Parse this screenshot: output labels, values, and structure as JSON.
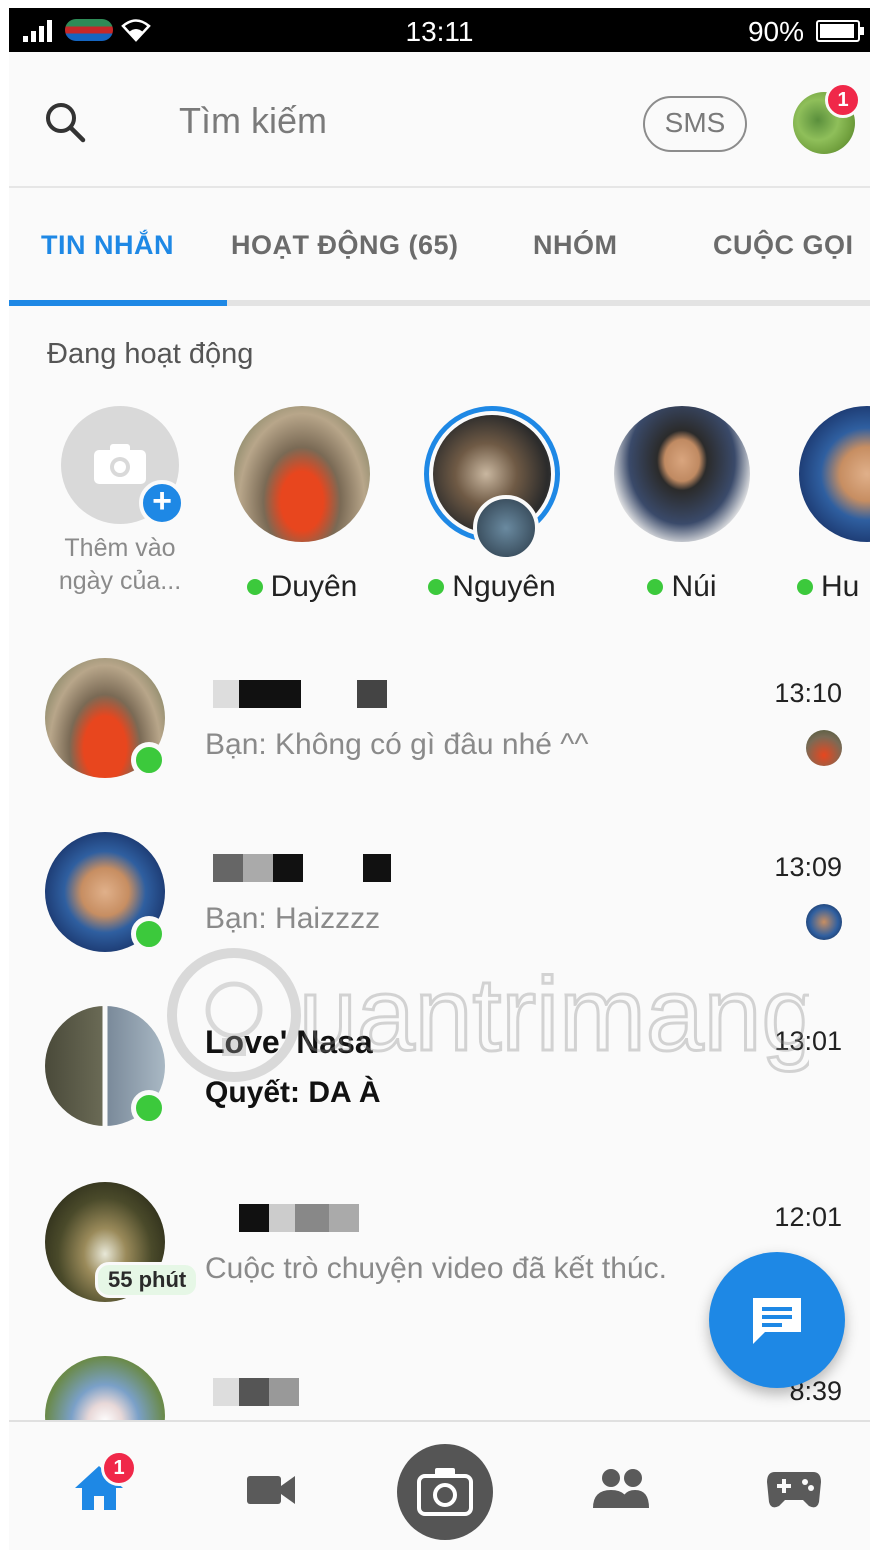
{
  "status_bar": {
    "time": "13:11",
    "battery_percent": "90%"
  },
  "top_bar": {
    "search_placeholder": "Tìm kiếm",
    "sms_label": "SMS",
    "profile_badge": "1"
  },
  "tabs": [
    {
      "label": "TIN NHẮN",
      "active": true
    },
    {
      "label": "HOẠT ĐỘNG (65)",
      "active": false
    },
    {
      "label": "NHÓM",
      "active": false
    },
    {
      "label": "CUỘC GỌI",
      "active": false
    }
  ],
  "active_now": {
    "title": "Đang hoạt động",
    "add_story_label_line1": "Thêm vào",
    "add_story_label_line2": "ngày của...",
    "users": [
      {
        "name": "Duyên"
      },
      {
        "name": "Nguyên"
      },
      {
        "name": "Núi"
      },
      {
        "name": "Hu"
      }
    ]
  },
  "conversations": [
    {
      "name": "",
      "preview": "Bạn: Không có gì đâu nhé ^^",
      "time": "13:10"
    },
    {
      "name": "",
      "preview": "Bạn: Haizzzz",
      "time": "13:09"
    },
    {
      "name": "Love' Nasa",
      "preview": "Quyết: DA À",
      "time": "13:01"
    },
    {
      "name": "",
      "preview": "Cuộc trò chuyện video đã kết thúc.",
      "time": "12:01",
      "call_badge": "55 phút"
    },
    {
      "name": "",
      "preview": "",
      "time": "8:39"
    }
  ],
  "watermark": "uantrimang",
  "bottom_nav": {
    "home_badge": "1"
  },
  "colors": {
    "accent": "#1e88e5",
    "online": "#3cc93c",
    "badge": "#f02849"
  }
}
